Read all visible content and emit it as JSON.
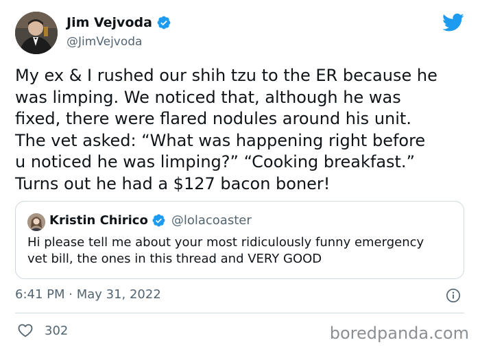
{
  "author": {
    "display_name": "Jim Vejvoda",
    "handle": "@JimVejvoda",
    "verified": true
  },
  "tweet": {
    "text": "My ex & I rushed our shih tzu to the ER because he\nwas limping. We noticed that, although he was\nfixed, there were flared nodules around his unit.\nThe vet asked: “What was happening right before\nu noticed he was limping?” “Cooking breakfast.”\nTurns out he had a $127 bacon boner!",
    "timestamp": "6:41 PM · May 31, 2022",
    "likes": "302"
  },
  "quoted_tweet": {
    "display_name": "Kristin Chirico",
    "handle": "@lolacoaster",
    "verified": true,
    "text": "Hi please tell me about your most ridiculously funny emergency\nvet bill, the ones in this thread and VERY GOOD"
  },
  "icons": {
    "platform": "twitter-bird-icon",
    "verified": "verified-badge-icon",
    "info": "info-icon",
    "like": "heart-icon"
  },
  "colors": {
    "brand_blue": "#1d9bf0",
    "text_primary": "#0f1419",
    "text_secondary": "#536471",
    "border": "#cfd9de"
  },
  "watermark": "boredpanda.com"
}
